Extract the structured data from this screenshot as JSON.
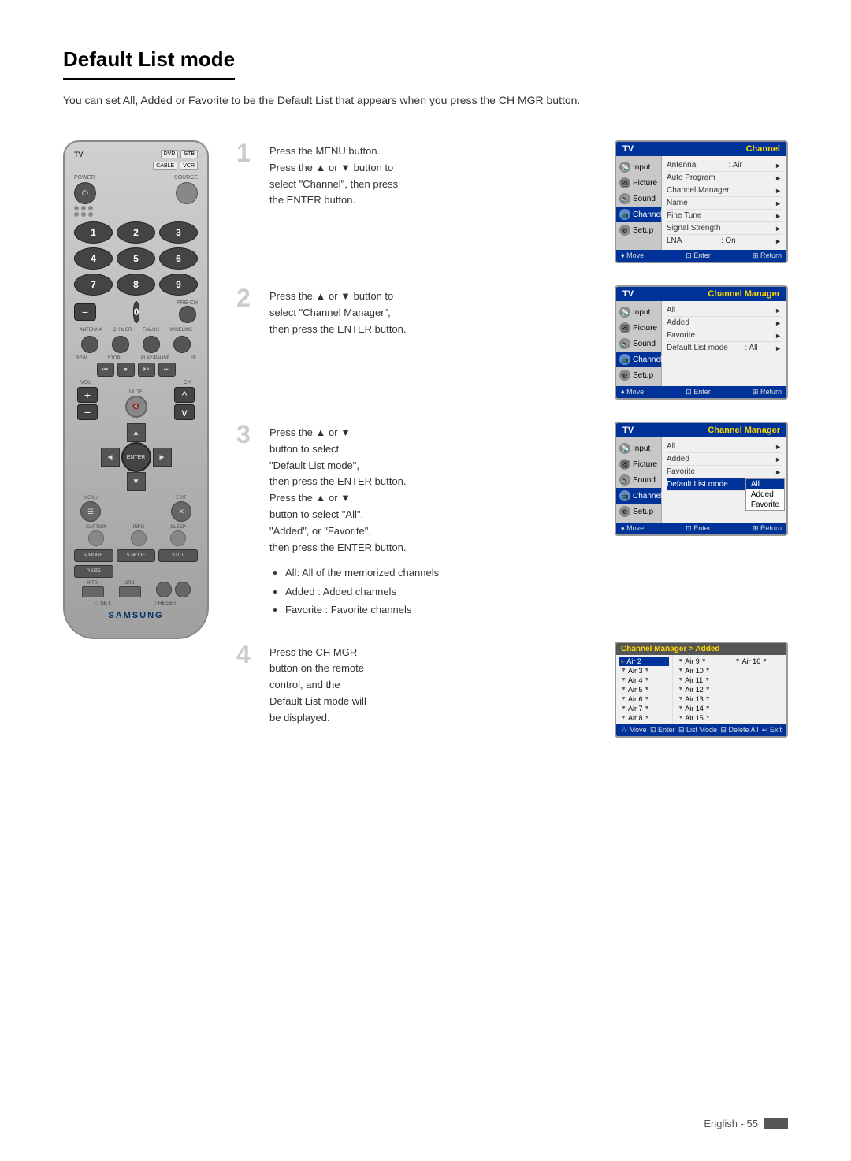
{
  "page": {
    "title": "Default List mode",
    "description": "You can set All, Added or Favorite to be the Default List that appears when you press the CH MGR button.",
    "footer": "English - 55"
  },
  "remote": {
    "tv_label": "TV",
    "boxes": [
      "DVD",
      "STB",
      "CABLE",
      "VCR"
    ],
    "power_label": "POWER",
    "source_label": "SOURCE",
    "numbers": [
      "1",
      "2",
      "3",
      "4",
      "5",
      "6",
      "7",
      "8",
      "9",
      "-",
      "0",
      ""
    ],
    "prech_label": "PRE-CH",
    "labels_row": [
      "ANTENNA",
      "CH MGR",
      "FAV.CH",
      "WISELINK"
    ],
    "vol_label": "VOL",
    "ch_label": "CH",
    "mute_label": "MUTE",
    "enter_label": "ENTER",
    "menu_label": "MENU",
    "exit_label": "EXIT",
    "caption_labels": [
      "CAPTION",
      "INFO",
      "SLEEP"
    ],
    "bottom_btns": [
      "P.MODE",
      "S.MODE",
      "STILL",
      "P.SIZE",
      "MTS",
      "SRS"
    ],
    "set_reset": [
      "○ SET",
      "○ RESET"
    ],
    "samsung_logo": "SAMSUNG"
  },
  "steps": [
    {
      "number": "1",
      "text": "Press the MENU button.\nPress the ▲ or ▼ button to select \"Channel\", then press the ENTER button.",
      "screen": {
        "header_tv": "TV",
        "header_title": "Channel",
        "sidebar_items": [
          "Input",
          "Picture",
          "Sound",
          "Channel",
          "Setup"
        ],
        "active_sidebar": "Channel",
        "menu_rows": [
          {
            "label": "Antenna",
            "value": ": Air",
            "arrow": "►"
          },
          {
            "label": "Auto Program",
            "value": "",
            "arrow": "►"
          },
          {
            "label": "Channel Manager",
            "value": "",
            "arrow": "►"
          },
          {
            "label": "Name",
            "value": "",
            "arrow": "►"
          },
          {
            "label": "Fine Tune",
            "value": "",
            "arrow": "►"
          },
          {
            "label": "Signal Strength",
            "value": "",
            "arrow": "►"
          },
          {
            "label": "LNA",
            "value": ": On",
            "arrow": "►"
          }
        ],
        "footer": [
          "♦ Move",
          "⊡ Enter",
          "⊞ Return"
        ]
      }
    },
    {
      "number": "2",
      "text": "Press the ▲ or ▼ button to select \"Channel Manager\", then press the ENTER button.",
      "screen": {
        "header_tv": "TV",
        "header_title": "Channel Manager",
        "sidebar_items": [
          "Input",
          "Picture",
          "Sound",
          "Channel",
          "Setup"
        ],
        "active_sidebar": "Channel",
        "menu_rows": [
          {
            "label": "All",
            "value": "",
            "arrow": "►"
          },
          {
            "label": "Added",
            "value": "",
            "arrow": "►"
          },
          {
            "label": "Favorite",
            "value": "",
            "arrow": "►"
          },
          {
            "label": "Default List mode",
            "value": ": All",
            "arrow": "►"
          }
        ],
        "footer": [
          "♦ Move",
          "⊡ Enter",
          "⊞ Return"
        ]
      }
    },
    {
      "number": "3",
      "text": "Press the ▲ or ▼ button to select \"Default List mode\", then press the ENTER button.\nPress the ▲ or ▼ button to select \"All\", \"Added\", or \"Favorite\", then press the ENTER button.",
      "screen": {
        "header_tv": "TV",
        "header_title": "Channel Manager",
        "sidebar_items": [
          "Input",
          "Picture",
          "Sound",
          "Channel",
          "Setup"
        ],
        "active_sidebar": "Channel",
        "menu_rows": [
          {
            "label": "All",
            "value": "",
            "arrow": "►"
          },
          {
            "label": "Added",
            "value": "",
            "arrow": "►"
          },
          {
            "label": "Favorite",
            "value": "",
            "arrow": "►"
          },
          {
            "label": "Default List mode",
            "value": "",
            "arrow": "",
            "highlighted": true
          }
        ],
        "dropdown": [
          "All",
          "Added",
          "Favorite"
        ],
        "dropdown_selected": "All",
        "footer": [
          "♦ Move",
          "⊡ Enter",
          "⊞ Return"
        ]
      }
    },
    {
      "number": "4",
      "text": "Press the CH MGR button on the remote control, and the Default List mode will be displayed.",
      "channel_screen": {
        "header_title": "Channel Manager > Added",
        "columns": [
          [
            "Air 2",
            "Air 3",
            "Air 4",
            "Air 5",
            "Air 6",
            "Air 7",
            "Air 8"
          ],
          [
            "Air 9",
            "Air 10",
            "Air 11",
            "Air 12",
            "Air 13",
            "Air 14",
            "Air 15"
          ],
          [
            "Air 16",
            "",
            "",
            "",
            "",
            "",
            ""
          ]
        ],
        "footer": [
          "☆ Move",
          "⊡ Enter",
          "⊟ List Mode",
          "⊟ Delete All",
          "↩ Exit"
        ]
      }
    }
  ],
  "bullets": [
    "All: All of the memorized channels",
    "Added : Added channels",
    "Favorite : Favorite channels"
  ]
}
